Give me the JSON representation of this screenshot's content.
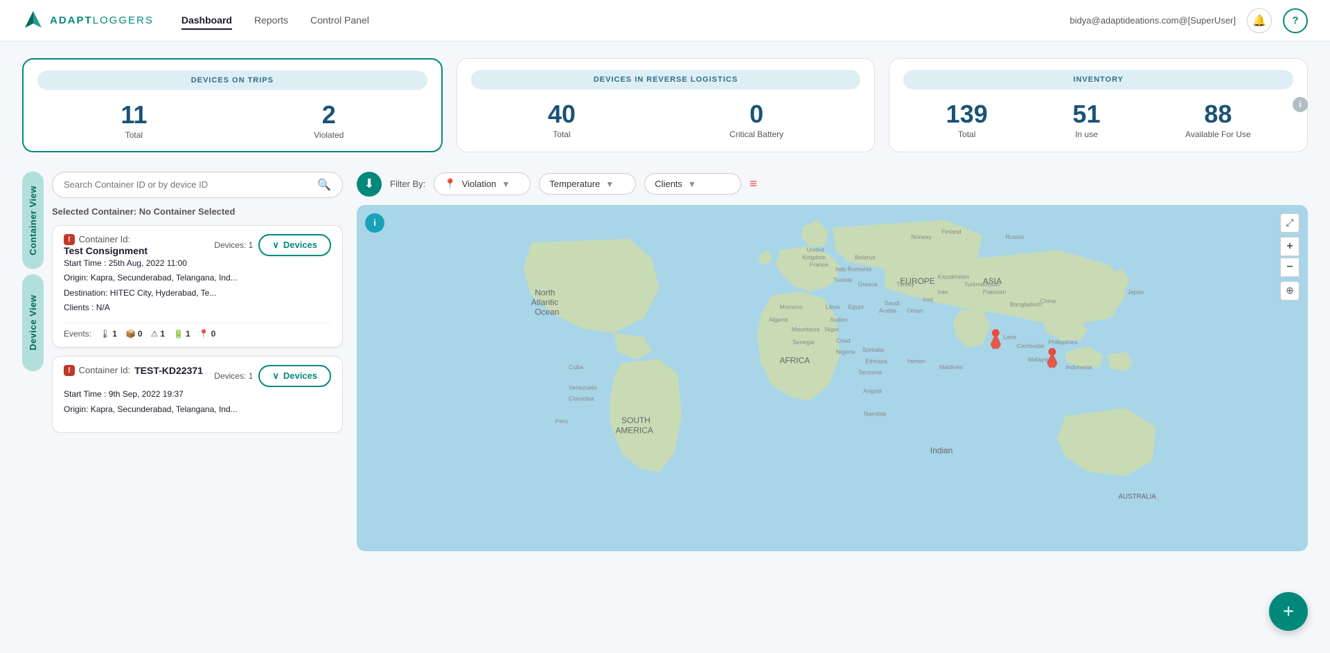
{
  "header": {
    "logo_text_bold": "ADAPT",
    "logo_text_light": "LOGGERS",
    "nav": [
      {
        "label": "Dashboard",
        "active": true
      },
      {
        "label": "Reports",
        "active": false
      },
      {
        "label": "Control Panel",
        "active": false
      }
    ],
    "user_email": "bidya@adaptideations.com@[SuperUser]",
    "bell_aria": "Notifications",
    "help_aria": "Help"
  },
  "stats": {
    "card1": {
      "title": "DEVICES ON TRIPS",
      "values": [
        {
          "number": "11",
          "label": "Total"
        },
        {
          "number": "2",
          "label": "Violated"
        }
      ]
    },
    "card2": {
      "title": "DEVICES IN REVERSE LOGISTICS",
      "values": [
        {
          "number": "40",
          "label": "Total"
        },
        {
          "number": "0",
          "label": "Critical Battery"
        }
      ]
    },
    "card3": {
      "title": "INVENTORY",
      "values": [
        {
          "number": "139",
          "label": "Total"
        },
        {
          "number": "51",
          "label": "In use"
        },
        {
          "number": "88",
          "label": "Available For Use"
        }
      ]
    }
  },
  "side_tabs": [
    {
      "label": "Container View"
    },
    {
      "label": "Device View"
    }
  ],
  "search": {
    "placeholder": "Search Container ID or by device ID"
  },
  "selected_container": {
    "label": "Selected Container:",
    "value": "No Container Selected"
  },
  "containers": [
    {
      "id_label": "Container Id:",
      "id_value": "",
      "name": "Test Consignment",
      "devices_count": "Devices: 1",
      "violated": true,
      "start_time_label": "Start Time :",
      "start_time": "25th Aug, 2022 11:00",
      "origin_label": "Origin:",
      "origin": "Kapra, Secunderabad, Telangana, Ind...",
      "destination_label": "Destination:",
      "destination": "HITEC City, Hyderabad, Te...",
      "clients_label": "Clients :",
      "clients": "N/A",
      "devices_btn": "Devices",
      "events_label": "Events:",
      "events": [
        {
          "icon": "🌡",
          "count": "1"
        },
        {
          "icon": "📦",
          "count": "0"
        },
        {
          "icon": "⚠",
          "count": "1"
        },
        {
          "icon": "🔋",
          "count": "1"
        },
        {
          "icon": "📍",
          "count": "0"
        }
      ]
    },
    {
      "id_label": "Container Id:",
      "id_value": "TEST-KD22371",
      "name": "",
      "devices_count": "Devices: 1",
      "violated": true,
      "start_time_label": "Start Time :",
      "start_time": "9th Sep, 2022 19:37",
      "origin_label": "Origin:",
      "origin": "Kapra, Secunderabad, Telangana, Ind...",
      "destination_label": "Destination:",
      "destination": "",
      "clients_label": "",
      "clients": "",
      "devices_btn": "Devices",
      "events_label": "",
      "events": []
    }
  ],
  "map": {
    "filter_label": "Filter By:",
    "filter_violation": "Violation",
    "filter_temperature": "Temperature",
    "filter_clients": "Clients",
    "info_icon": "i",
    "zoom_in": "+",
    "zoom_out": "−",
    "expand_icon": "⤢",
    "reset_icon": "⊕"
  },
  "fab": {
    "icon": "+"
  }
}
